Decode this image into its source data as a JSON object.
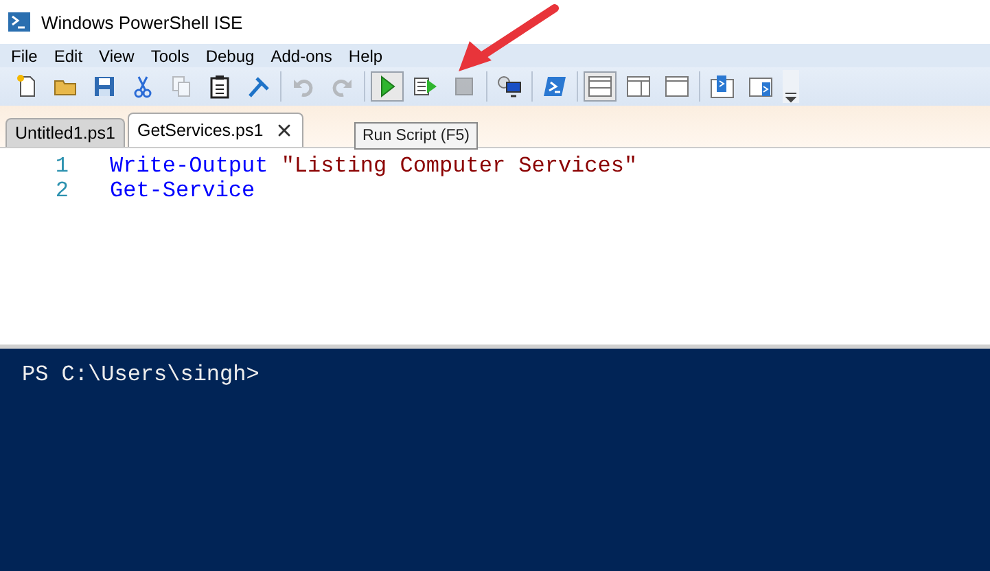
{
  "window": {
    "title": "Windows PowerShell ISE"
  },
  "menu": [
    "File",
    "Edit",
    "View",
    "Tools",
    "Debug",
    "Add-ons",
    "Help"
  ],
  "toolbar": [
    [
      {
        "kind": "new",
        "disabled": false,
        "selected": false
      },
      {
        "kind": "open",
        "disabled": false,
        "selected": false
      },
      {
        "kind": "save",
        "disabled": false,
        "selected": false
      },
      {
        "kind": "cut",
        "disabled": false,
        "selected": false
      },
      {
        "kind": "copy",
        "disabled": true,
        "selected": false
      },
      {
        "kind": "paste",
        "disabled": false,
        "selected": false
      },
      {
        "kind": "clear",
        "disabled": false,
        "selected": false
      }
    ],
    [
      {
        "kind": "undo",
        "disabled": true,
        "selected": false
      },
      {
        "kind": "redo",
        "disabled": true,
        "selected": false
      }
    ],
    [
      {
        "kind": "run",
        "disabled": false,
        "selected": true
      },
      {
        "kind": "run-selection",
        "disabled": false,
        "selected": false
      },
      {
        "kind": "stop",
        "disabled": true,
        "selected": false
      }
    ],
    [
      {
        "kind": "remote",
        "disabled": false,
        "selected": false
      }
    ],
    [
      {
        "kind": "powershell",
        "disabled": false,
        "selected": false
      }
    ],
    [
      {
        "kind": "layout-top",
        "disabled": false,
        "selected": true
      },
      {
        "kind": "layout-right",
        "disabled": false,
        "selected": false
      },
      {
        "kind": "layout-max",
        "disabled": false,
        "selected": false
      }
    ],
    [
      {
        "kind": "show-script",
        "disabled": false,
        "selected": false
      },
      {
        "kind": "hide-script",
        "disabled": false,
        "selected": false
      }
    ]
  ],
  "tooltip": "Run Script (F5)",
  "tabs": [
    {
      "label": "Untitled1.ps1",
      "selected": false
    },
    {
      "label": "GetServices.ps1",
      "selected": true
    }
  ],
  "editor": {
    "lines": [
      {
        "number": "1",
        "tokens": [
          {
            "kind": "cmdlet",
            "text": "Write-Output"
          },
          {
            "kind": "string",
            "text": "\"Listing Computer Services\""
          }
        ]
      },
      {
        "number": "2",
        "tokens": [
          {
            "kind": "cmdlet",
            "text": "Get-Service"
          }
        ]
      }
    ]
  },
  "console": {
    "prompt": "PS C:\\Users\\singh>"
  }
}
